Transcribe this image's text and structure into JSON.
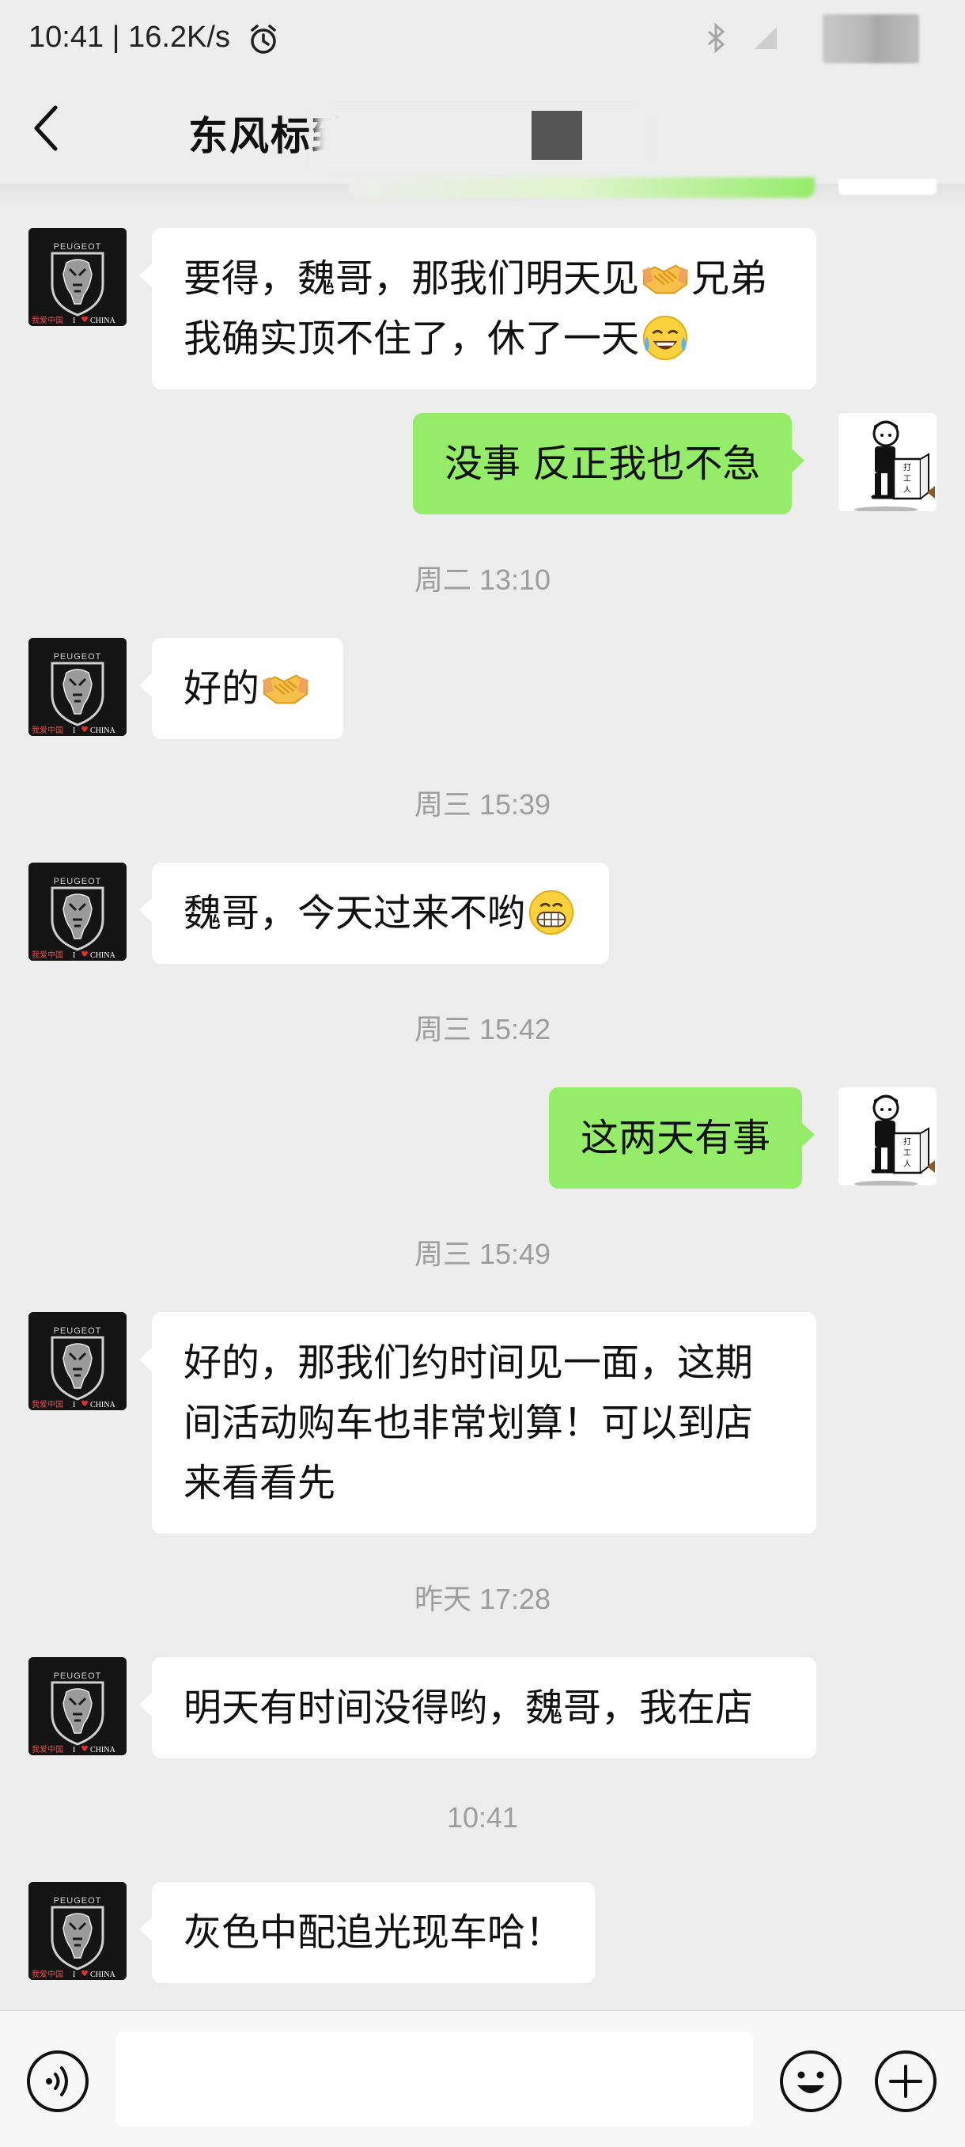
{
  "status_bar": {
    "time_speed": "10:41 | 16.2K/s",
    "icons": [
      "alarm-icon",
      "bluetooth-icon",
      "signal-icon",
      "battery-icon"
    ]
  },
  "nav": {
    "title": "东风标致",
    "back_icon": "chevron-left-icon"
  },
  "avatars": {
    "contact": {
      "brand_text": "PEUGEOT",
      "caption": "我爱中国 I ❤ CHINA",
      "icon": "peugeot-lion-logo"
    },
    "self": {
      "box_text": "打工人",
      "icon": "cartoon-worker-avatar"
    }
  },
  "messages": [
    {
      "side": "in",
      "text_1": "要得，魏哥，那我们明天见",
      "emoji_1": "handshake-emoji",
      "text_2": "兄弟我确实顶不住了，休了一天",
      "emoji_2": "crying-laughing-emoji"
    },
    {
      "side": "out",
      "text": "没事 反正我也不急"
    },
    {
      "side": "time",
      "text": "周二 13:10"
    },
    {
      "side": "in",
      "text": "好的",
      "emoji": "handshake-emoji"
    },
    {
      "side": "time",
      "text": "周三 15:39"
    },
    {
      "side": "in",
      "text": "魏哥，今天过来不哟",
      "emoji": "grinning-emoji"
    },
    {
      "side": "time",
      "text": "周三 15:42"
    },
    {
      "side": "out",
      "text": "这两天有事"
    },
    {
      "side": "time",
      "text": "周三 15:49"
    },
    {
      "side": "in",
      "line_1": "好的，那我们约时间见一面，这期",
      "line_2": "间活动购车也非常划算！可以到店",
      "line_3": "来看看先"
    },
    {
      "side": "time",
      "text": "昨天 17:28"
    },
    {
      "side": "in",
      "text": "明天有时间没得哟，魏哥，我在店"
    },
    {
      "side": "time",
      "text": "10:41"
    },
    {
      "side": "in",
      "text": "灰色中配追光现车哈！"
    }
  ],
  "input_bar": {
    "placeholder": "",
    "voice_icon": "voice-icon",
    "emoji_icon": "smiley-icon",
    "plus_icon": "plus-circle-icon"
  },
  "colors": {
    "background": "#ededed",
    "self_bubble": "#95ec69",
    "contact_bubble": "#ffffff",
    "timestamp": "#9d9d9d"
  }
}
